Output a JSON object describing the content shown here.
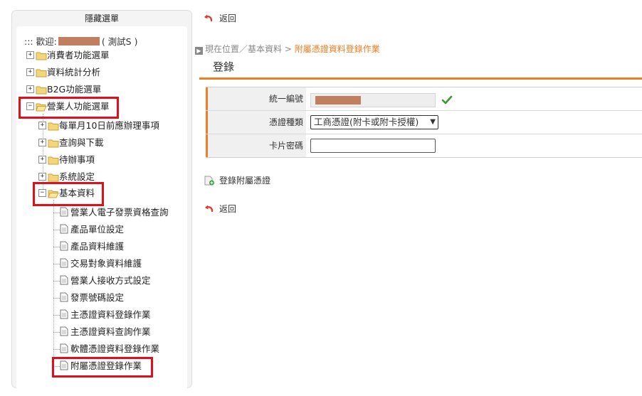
{
  "sidebar": {
    "header": "隱藏選單",
    "welcome_prefix": "::: 歡迎:",
    "welcome_suffix": "( 測試S )",
    "menu": {
      "consumer": "消費者功能選單",
      "stats": "資料統計分析",
      "b2g": "B2G功能選單",
      "business": "營業人功能選單",
      "monthly": "每單月10日前應辦理事項",
      "query_download": "查詢與下載",
      "pending": "待辦事項",
      "system": "系統設定",
      "basic": "基本資料",
      "leaves": [
        "營業人電子發票資格查詢",
        "產品單位設定",
        "產品資料維護",
        "交易對象資料維護",
        "營業人接收方式設定",
        "發票號碼設定",
        "主憑證資料登錄作業",
        "主憑證資料查詢作業",
        "軟體憑證資料登錄作業",
        "附屬憑證登錄作業"
      ]
    }
  },
  "main": {
    "back_label": "返回",
    "breadcrumb": {
      "prefix": "現在位置／基本資料 >",
      "current": "附屬憑證資料登錄作業"
    },
    "title": "登錄",
    "form": {
      "tax_id_label": "統一編號",
      "cert_type_label": "憑證種類",
      "cert_type_value": "工商憑證(附卡或附卡授權)",
      "pin_label": "卡片密碼",
      "pin_value": ""
    },
    "register_label": "登錄附屬憑證",
    "back_label_bottom": "返回"
  },
  "colors": {
    "accent": "#f07d22",
    "highlight": "#e10e1c",
    "redaction": "#c07f5f"
  }
}
